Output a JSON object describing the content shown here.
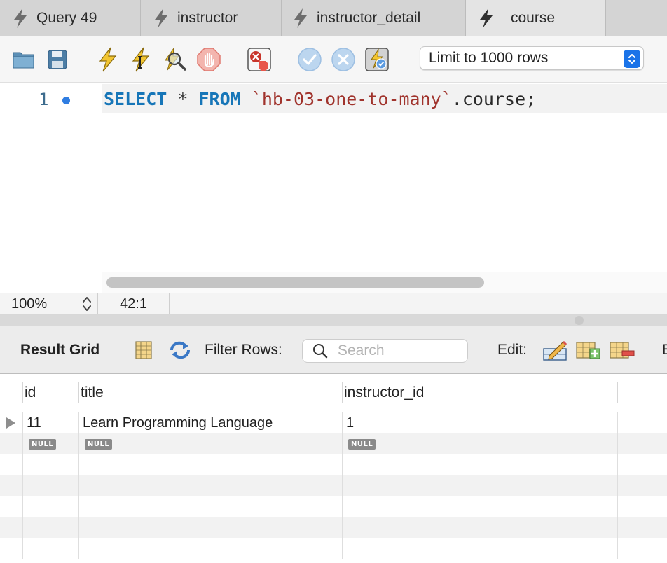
{
  "tabs": [
    {
      "label": "Query 49",
      "active": false
    },
    {
      "label": "instructor",
      "active": false
    },
    {
      "label": "instructor_detail",
      "active": false
    },
    {
      "label": "course",
      "active": true
    }
  ],
  "toolbar": {
    "icons": [
      "open-folder-icon",
      "save-icon",
      "execute-icon",
      "execute-current-icon",
      "explain-icon",
      "stop-icon",
      "toggle-stop-on-error-icon",
      "commit-icon",
      "rollback-icon",
      "autocommit-icon"
    ],
    "limit_label": "Limit to 1000 rows"
  },
  "editor": {
    "line_number": "1",
    "sql": {
      "select": "SELECT",
      "star": "*",
      "from": "FROM",
      "schema": "`hb-03-one-to-many`",
      "rest": ".course;"
    }
  },
  "status": {
    "zoom": "100%",
    "cursor": "42:1"
  },
  "result_toolbar": {
    "title": "Result Grid",
    "filter_label": "Filter Rows:",
    "search_placeholder": "Search",
    "edit_label": "Edit:",
    "cut_label": "E"
  },
  "grid": {
    "columns": [
      "id",
      "title",
      "instructor_id"
    ],
    "rows": [
      {
        "id": "11",
        "title": "Learn Programming Language",
        "instructor_id": "1"
      }
    ],
    "null_label": "NULL"
  },
  "colors": {
    "accent": "#1a73e8",
    "keyword": "#1776b8",
    "string": "#a0332c"
  }
}
